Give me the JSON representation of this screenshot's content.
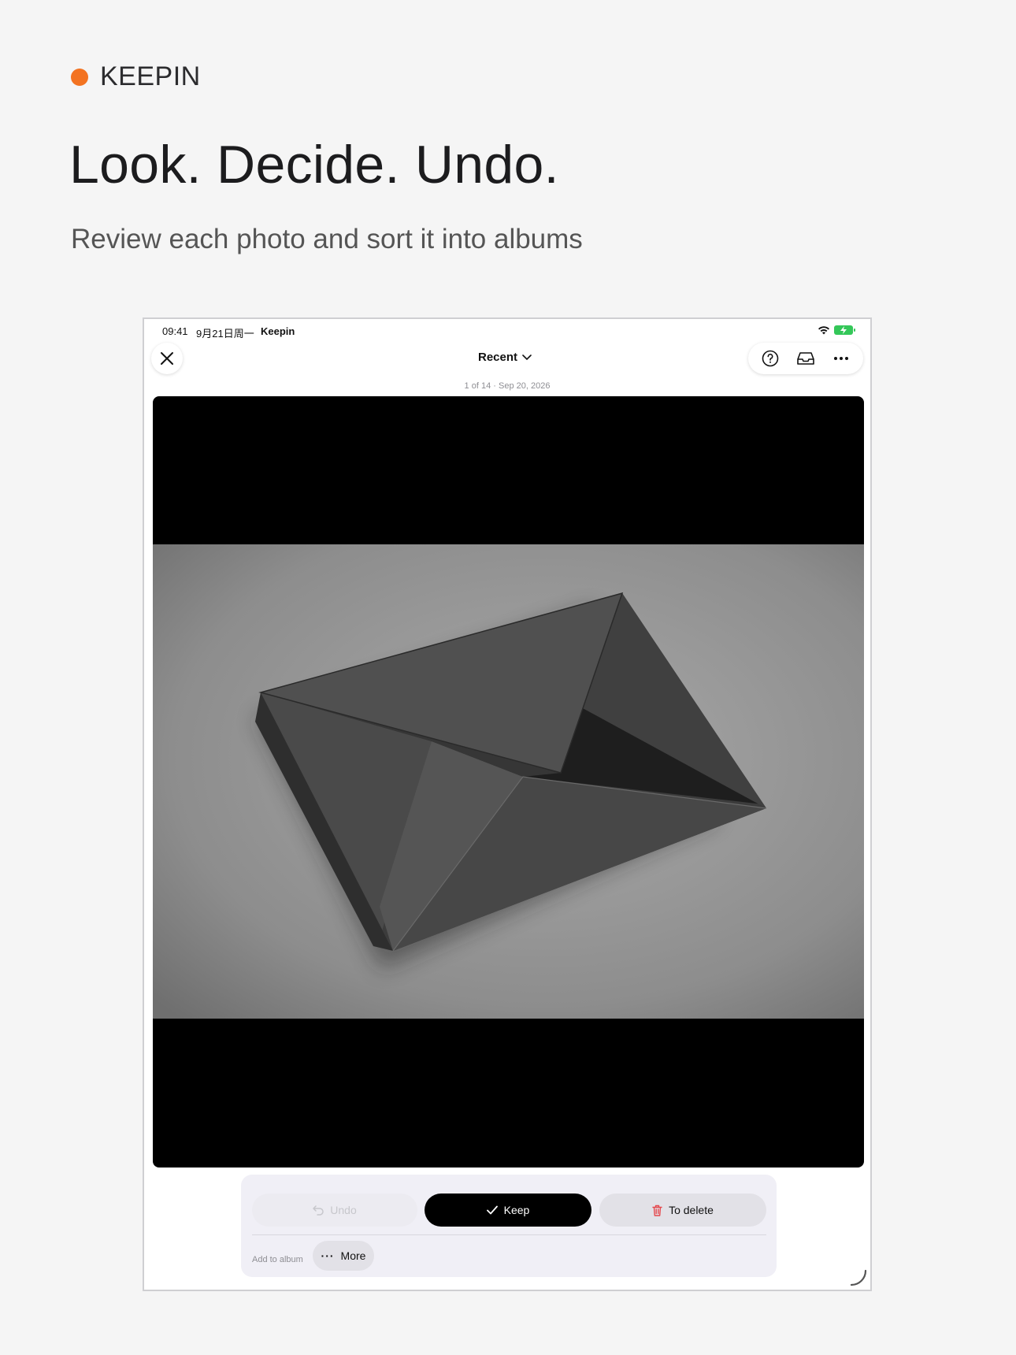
{
  "brand": {
    "name": "KEEPIN",
    "dot_color": "#f37321"
  },
  "hero": {
    "headline": "Look. Decide. Undo.",
    "subhead": "Review each photo and sort it into albums"
  },
  "statusbar": {
    "time": "09:41",
    "date": "9月21日周一",
    "app": "Keepin"
  },
  "navbar": {
    "album": "Recent",
    "actions": [
      "help-icon",
      "inbox-icon",
      "more-icon"
    ]
  },
  "meta": {
    "position": "1 of 14",
    "separator": "·",
    "date": "Sep 20, 2026"
  },
  "photo": {
    "subject": "folded dark gray paper envelope on concrete surface"
  },
  "actions": {
    "undo": "Undo",
    "keep": "Keep",
    "delete": "To delete",
    "add_to_album": "Add to album",
    "more": "More"
  },
  "colors": {
    "keep_bg": "#000000",
    "delete_icon": "#e5484d",
    "battery": "#34c759"
  }
}
